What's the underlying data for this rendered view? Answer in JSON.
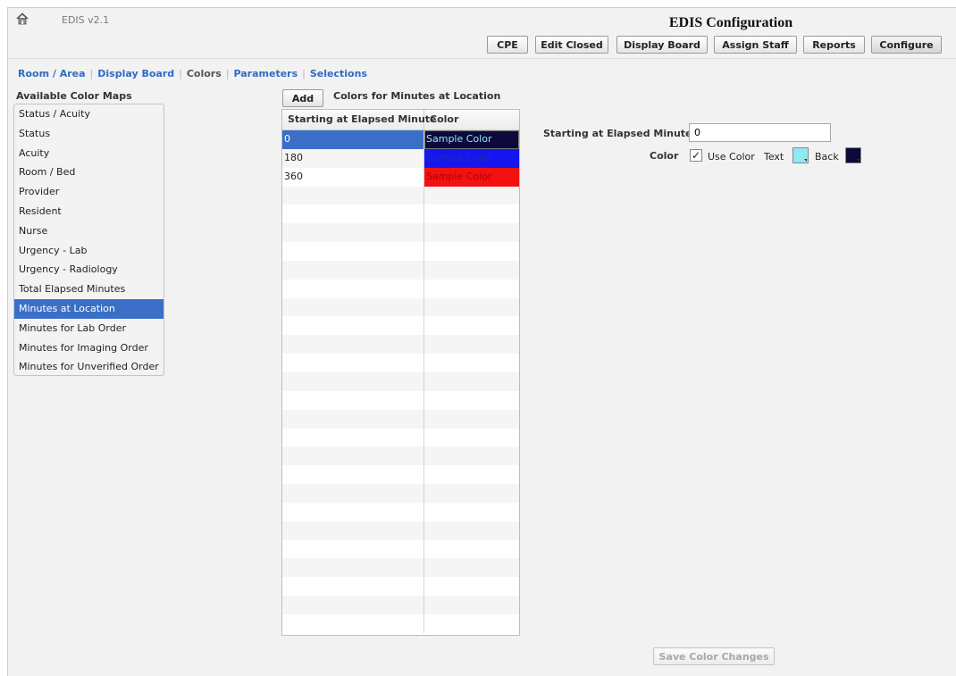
{
  "app": {
    "version": "EDIS v2.1",
    "title": "EDIS Configuration"
  },
  "header_buttons": [
    "CPE",
    "Edit Closed",
    "Display Board",
    "Assign Staff",
    "Reports",
    "Configure"
  ],
  "subnav": [
    {
      "label": "Room / Area",
      "current": false
    },
    {
      "label": "Display Board",
      "current": false
    },
    {
      "label": "Colors",
      "current": true
    },
    {
      "label": "Parameters",
      "current": false
    },
    {
      "label": "Selections",
      "current": false
    }
  ],
  "color_maps": {
    "label": "Available Color Maps",
    "selected": "Minutes at Location",
    "items": [
      "Status / Acuity",
      "Status",
      "Acuity",
      "Room / Bed",
      "Provider",
      "Resident",
      "Nurse",
      "Urgency - Lab",
      "Urgency - Radiology",
      "Total Elapsed Minutes",
      "Minutes at Location",
      "Minutes for Lab Order",
      "Minutes for Imaging Order",
      "Minutes for Unverified Order"
    ]
  },
  "grid": {
    "add_label": "Add",
    "title": "Colors for Minutes at Location",
    "columns": [
      "Starting at Elapsed Minute",
      "Color"
    ],
    "rows": [
      {
        "minute": "0",
        "sample": "Sample Color",
        "text_color": "#8fe9f0",
        "back_color": "#0b0a3a",
        "selected": true
      },
      {
        "minute": "180",
        "sample": "Sample Color",
        "text_color": "#2a2aa8",
        "back_color": "#1515f0",
        "selected": false
      },
      {
        "minute": "360",
        "sample": "Sample Color",
        "text_color": "#b40000",
        "back_color": "#f21212",
        "selected": false
      }
    ]
  },
  "form": {
    "minute_label": "Starting at Elapsed Minute",
    "minute_value": "0",
    "color_label": "Color",
    "use_color_checked": true,
    "use_color_label": "Use Color",
    "text_label": "Text",
    "text_swatch": "#8fe9f0",
    "back_label": "Back",
    "back_swatch": "#0b0a3a"
  },
  "save_label": "Save Color Changes",
  "colors": {
    "accent": "#3b6fc7",
    "link": "#2f6bc4"
  }
}
